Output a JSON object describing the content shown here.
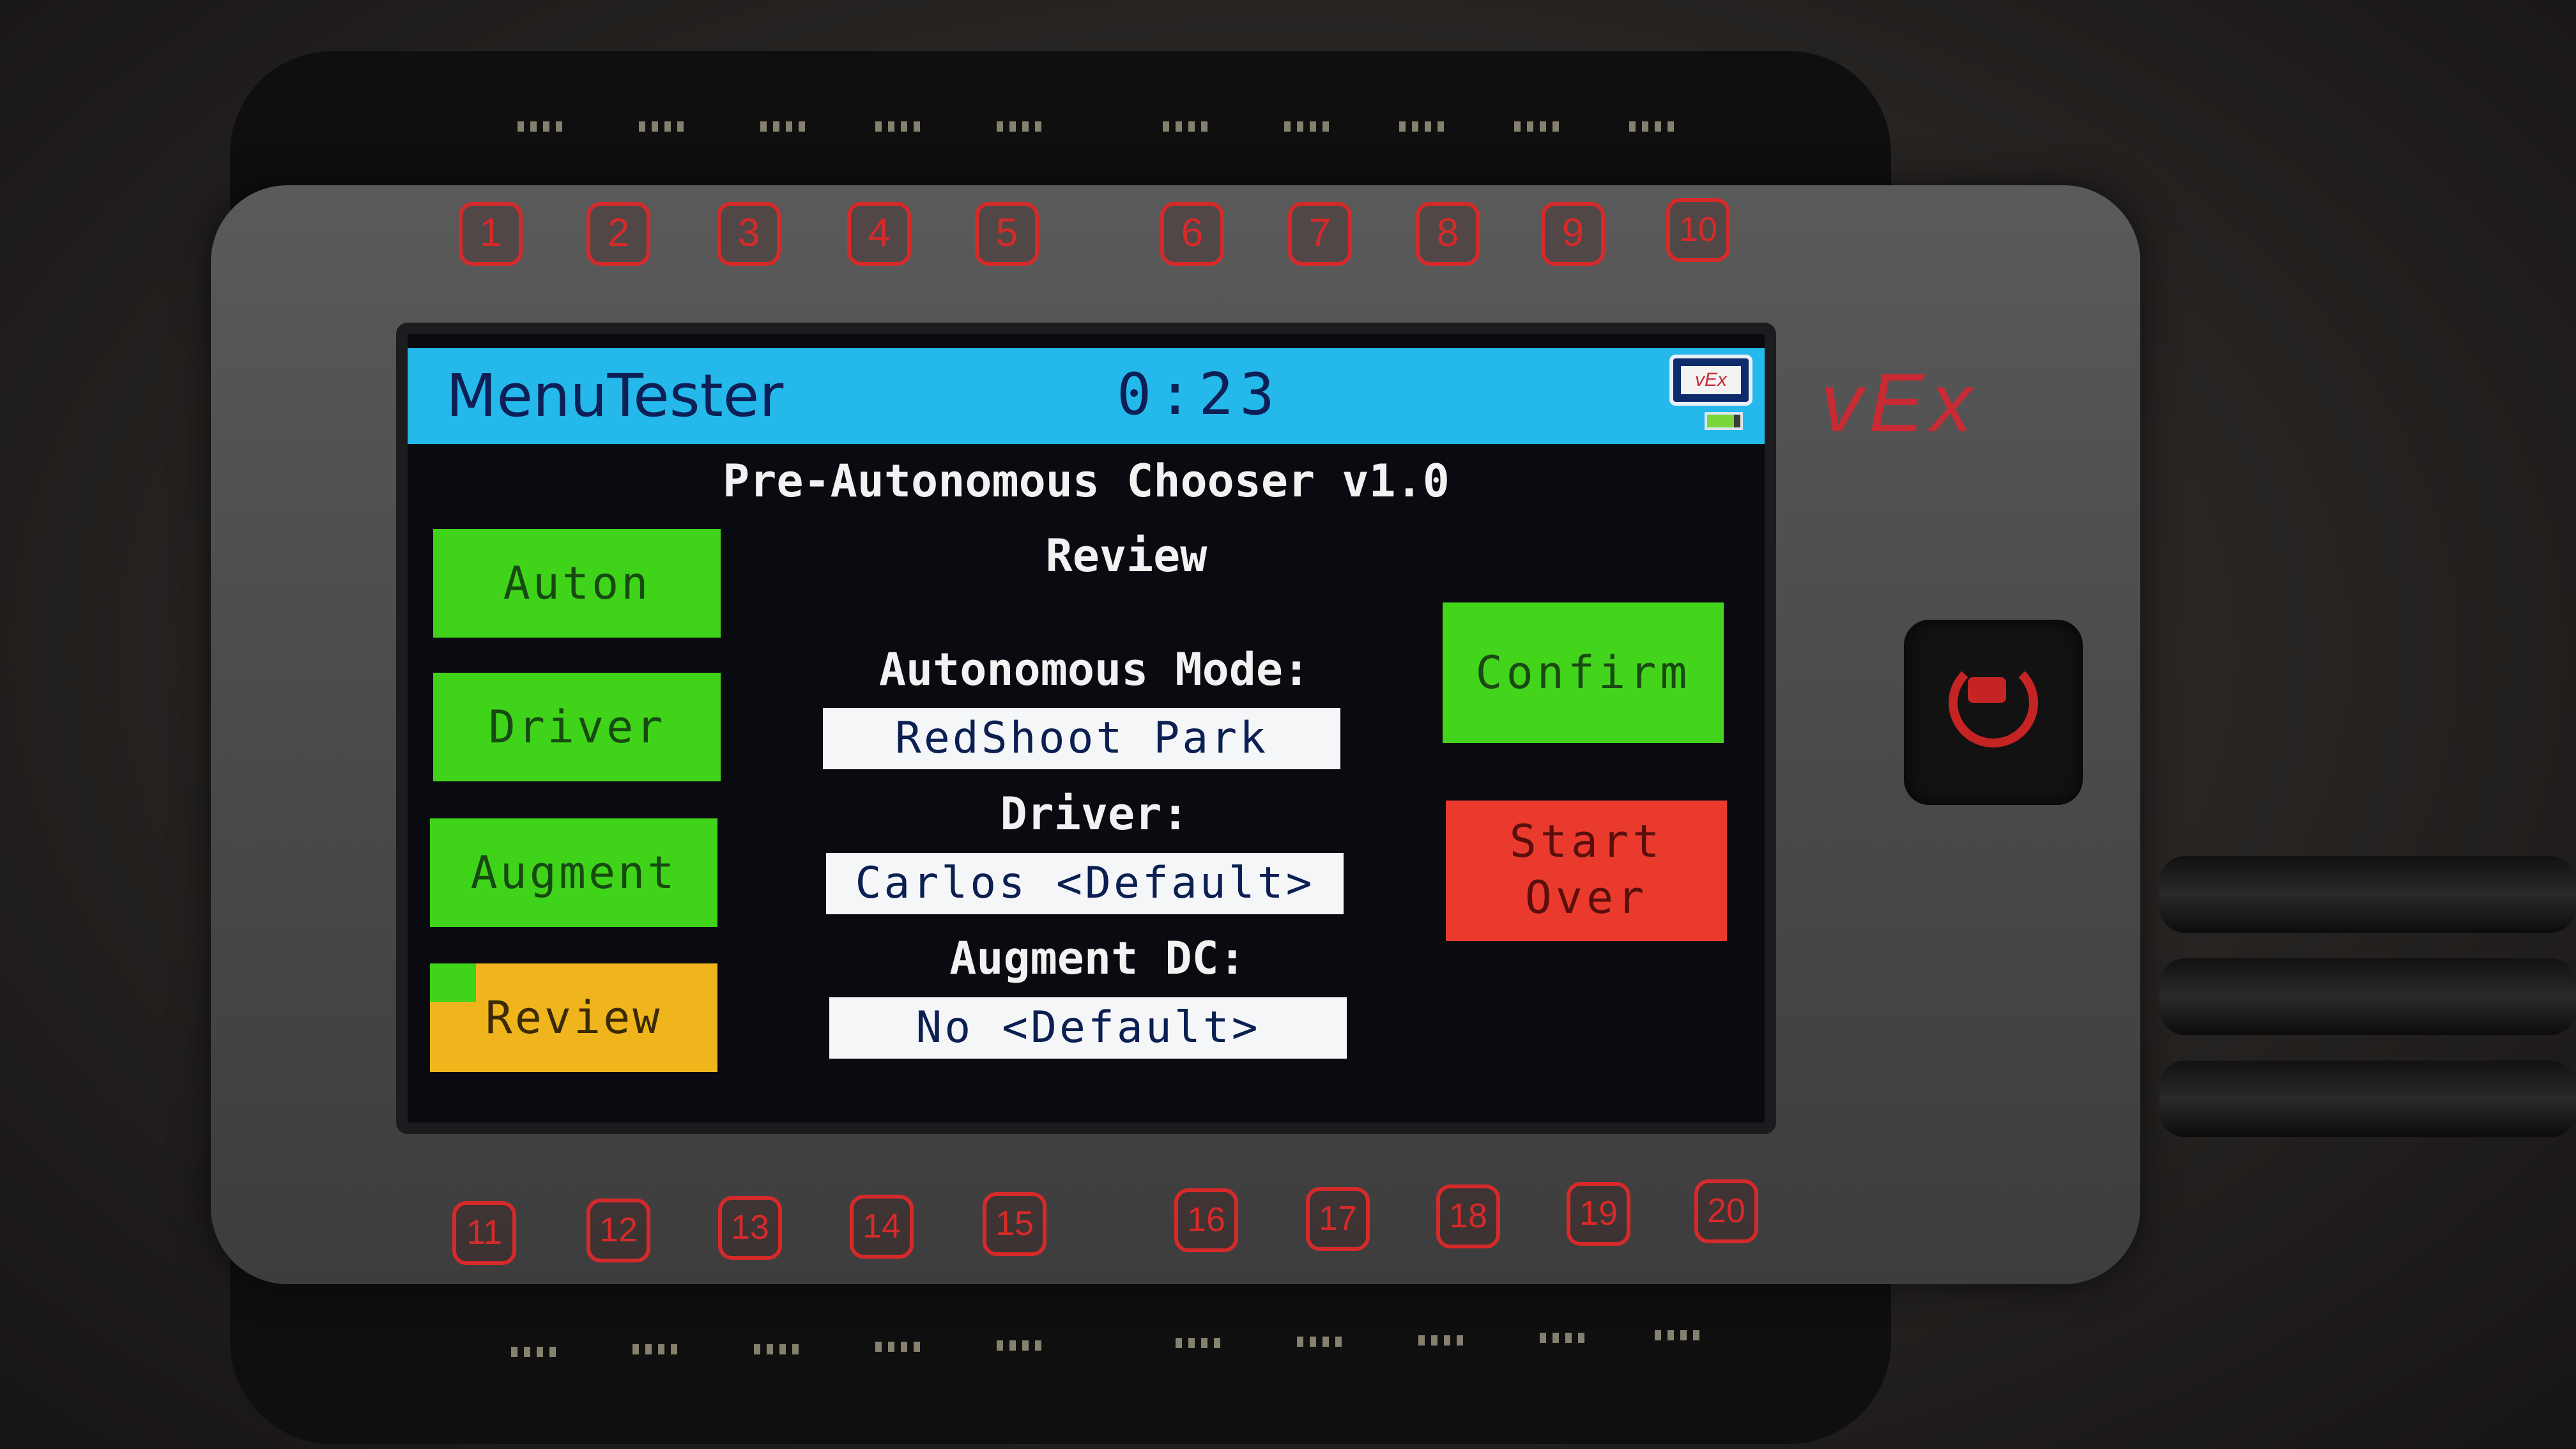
{
  "status_bar": {
    "program_name": "MenuTester",
    "timer": "0:23",
    "brand_icon": "vex-logo-icon",
    "battery_level_percent": 80
  },
  "screen": {
    "title": "Pre-Autonomous Chooser v1.0",
    "section_title": "Review",
    "menu": [
      {
        "label": "Auton",
        "color": "#3fd41a",
        "selected": false
      },
      {
        "label": "Driver",
        "color": "#3fd41a",
        "selected": false
      },
      {
        "label": "Augment",
        "color": "#3fd41a",
        "selected": false
      },
      {
        "label": "Review",
        "color": "#f0b51d",
        "selected": true
      }
    ],
    "review": {
      "autonomous_label": "Autonomous Mode:",
      "autonomous_value": "RedShoot Park",
      "driver_label": "Driver:",
      "driver_value": "Carlos <Default>",
      "augment_label": "Augment DC:",
      "augment_value": "No <Default>"
    },
    "confirm_label": "Confirm",
    "start_over_line1": "Start",
    "start_over_line2": "Over"
  },
  "device": {
    "brand": "vEx",
    "ports_top": [
      "1",
      "2",
      "3",
      "4",
      "5",
      "6",
      "7",
      "8",
      "9",
      "10"
    ],
    "ports_bottom": [
      "11",
      "12",
      "13",
      "14",
      "15",
      "16",
      "17",
      "18",
      "19",
      "20"
    ],
    "power_icon": "power-icon"
  },
  "colors": {
    "status_bar": "#25b8ea",
    "menu_green": "#3fd41a",
    "menu_selected": "#f0b51d",
    "start_over_red": "#ea3a2e",
    "port_red": "#d62a2a"
  }
}
